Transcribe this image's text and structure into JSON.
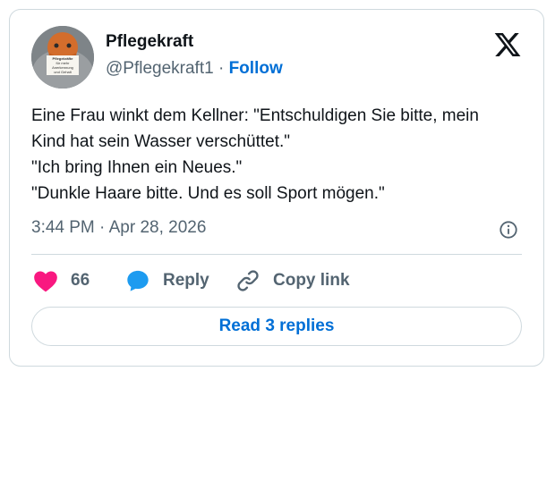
{
  "tweet": {
    "author_name": "Pflegekraft",
    "handle": "@Pflegekraft1",
    "separator": " · ",
    "follow_label": "Follow",
    "avatar_sign_text": [
      "Pflegekräfte",
      "für mehr",
      "Anerkennung",
      "und Gehalt"
    ],
    "text_lines": [
      "Eine Frau winkt dem Kellner: \"Entschuldigen Sie bitte, mein",
      "Kind hat sein Wasser verschüttet.\"",
      "\"Ich bring Ihnen ein Neues.\"",
      "\"Dunkle Haare bitte. Und es soll Sport mögen.\""
    ],
    "timestamp": "3:44 PM · Apr 28, 2026"
  },
  "actions": {
    "like_count": "66",
    "reply_label": "Reply",
    "copy_link_label": "Copy link"
  },
  "replies_button_label": "Read 3 replies",
  "colors": {
    "like": "#f91880",
    "reply": "#1d9bf0",
    "link_blue": "#006fd6",
    "secondary_text": "#536471",
    "border": "#cfd9de"
  },
  "icons": [
    "x-logo-icon",
    "info-icon",
    "heart-icon",
    "reply-bubble-icon",
    "link-icon"
  ]
}
